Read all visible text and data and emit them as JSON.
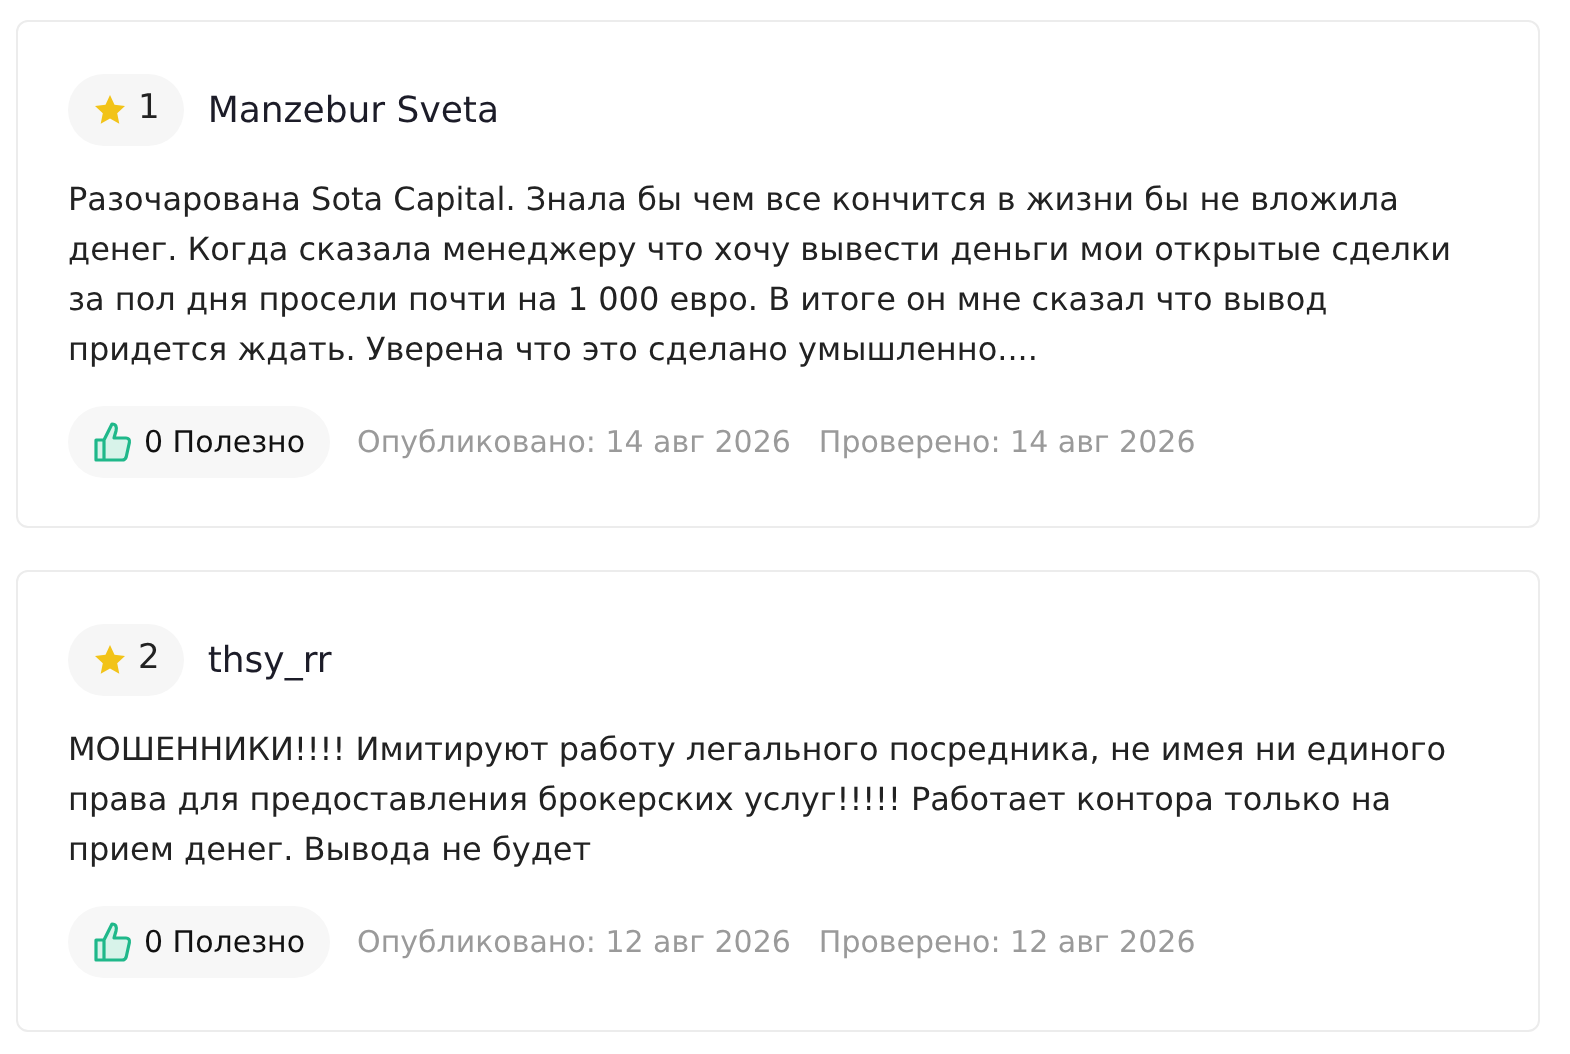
{
  "reviews": [
    {
      "rating": "1",
      "author": "Manzebur Sveta",
      "text": "Разочарована Sota Capital. Знала бы чем все кончится в жизни бы не вложила денег. Когда сказала менеджеру что хочу вывести деньги мои открытые сделки за пол дня просели почти на 1 000 евро. В итоге он мне сказал что вывод придется ждать. Уверена что это сделано умышленно....",
      "helpful": "0 Полезно",
      "published": "Опубликовано: 14 авг 2026",
      "verified": "Проверено: 14 авг 2026"
    },
    {
      "rating": "2",
      "author": "thsy_rr",
      "text": "МОШЕННИКИ!!!! Имитируют работу легального посредника, не имея ни единого права для предоставления брокерских услуг!!!!! Работает контора только на прием денег. Вывода не будет",
      "helpful": "0 Полезно",
      "published": "Опубликовано: 12 авг 2026",
      "verified": "Проверено: 12 авг 2026"
    }
  ]
}
